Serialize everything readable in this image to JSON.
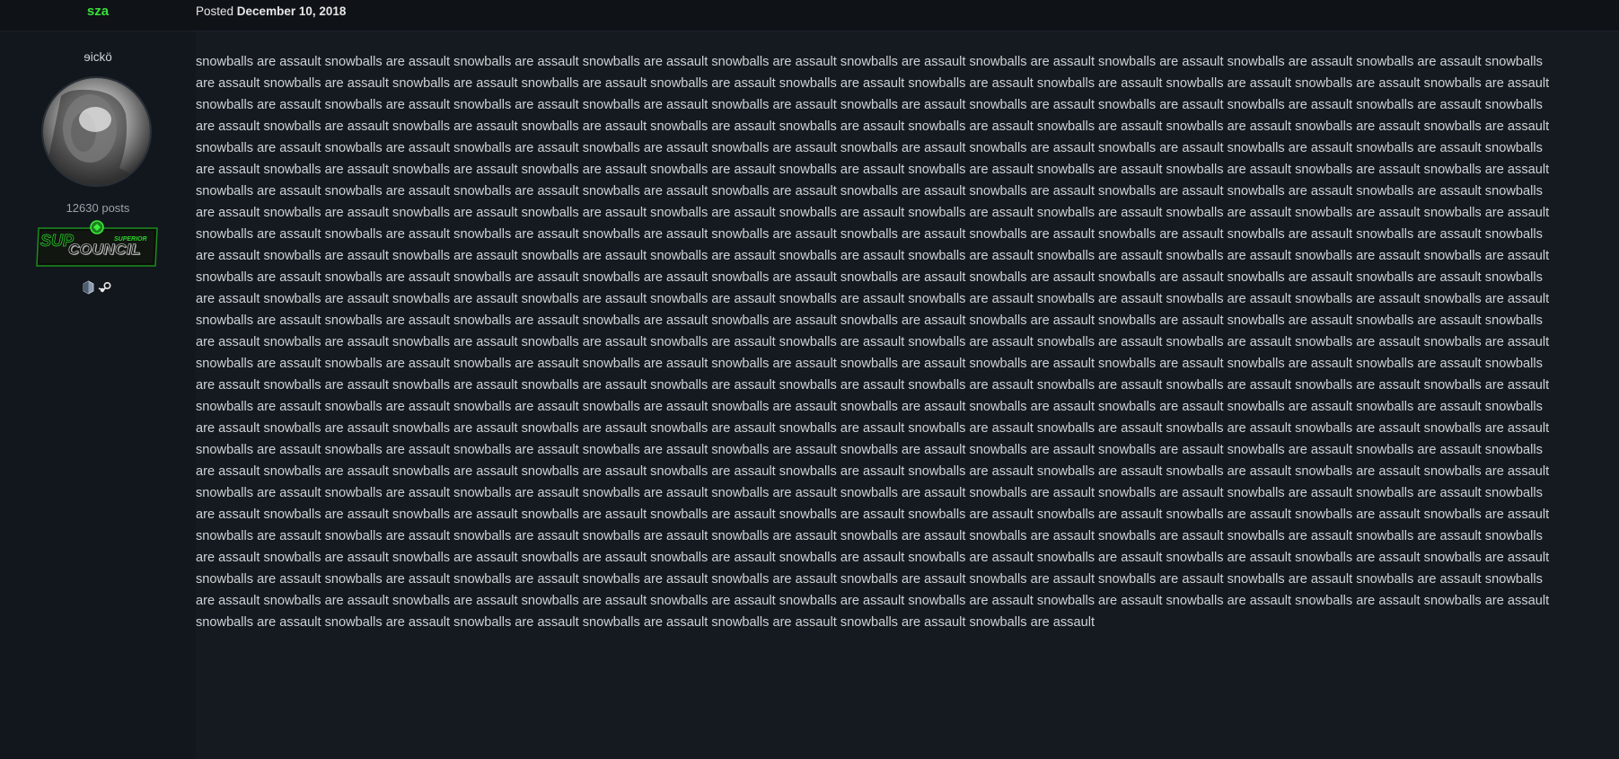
{
  "post": {
    "author": "sza",
    "posted_prefix": "Posted",
    "posted_date": "December 10, 2018"
  },
  "author_panel": {
    "user_title": "ɘickö",
    "post_count": "12630 posts",
    "badge": {
      "sup": "SUP",
      "superior": "SUPERIOR",
      "council": "COUNCIL"
    },
    "social_icons": [
      "steam-like-icon",
      "steam-icon"
    ]
  },
  "body": {
    "phrase": "snowballs are assault",
    "repeat_count": 280
  },
  "colors": {
    "author_green": "#38e038",
    "badge_green": "#2bd42b",
    "background": "#151a20",
    "topbar": "#0f1216",
    "text": "#cfd3d6"
  }
}
